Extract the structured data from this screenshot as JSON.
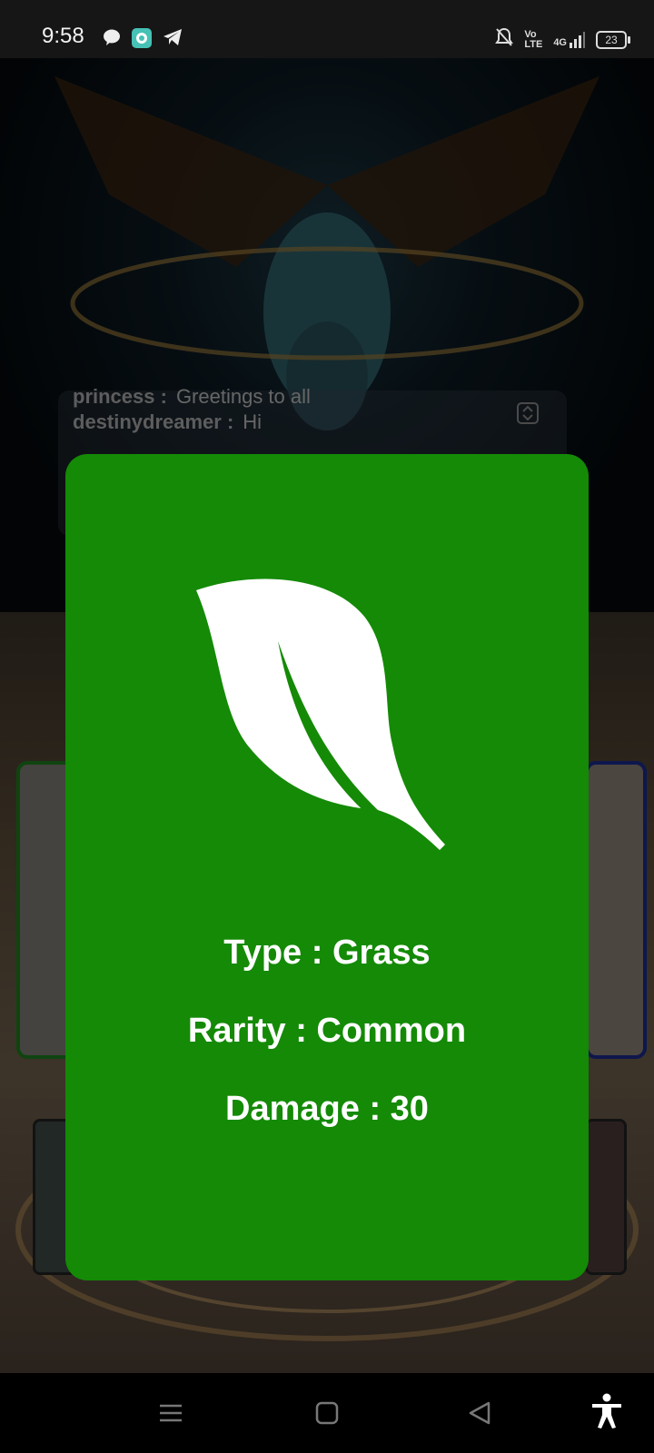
{
  "status_bar": {
    "time": "9:58",
    "battery": "23",
    "signal_label": "4G",
    "icons_left": [
      "chat-bubble-icon",
      "app-icon",
      "telegram-icon"
    ],
    "icons_right": [
      "bell-off-icon",
      "volte-icon",
      "signal-icon",
      "battery-icon"
    ]
  },
  "chat": {
    "line1_user": "princess :",
    "line1_msg": "Greetings to all",
    "line2_user": "destinydreamer :",
    "line2_msg": "Hi"
  },
  "card": {
    "color": "#148a06",
    "icon": "leaf-icon",
    "type_text": "Type : Grass",
    "rarity_text": "Rarity : Common",
    "damage_text": "Damage : 30"
  },
  "nav_bar": {
    "buttons": [
      "menu-icon",
      "home-icon",
      "back-icon",
      "accessibility-icon"
    ]
  }
}
